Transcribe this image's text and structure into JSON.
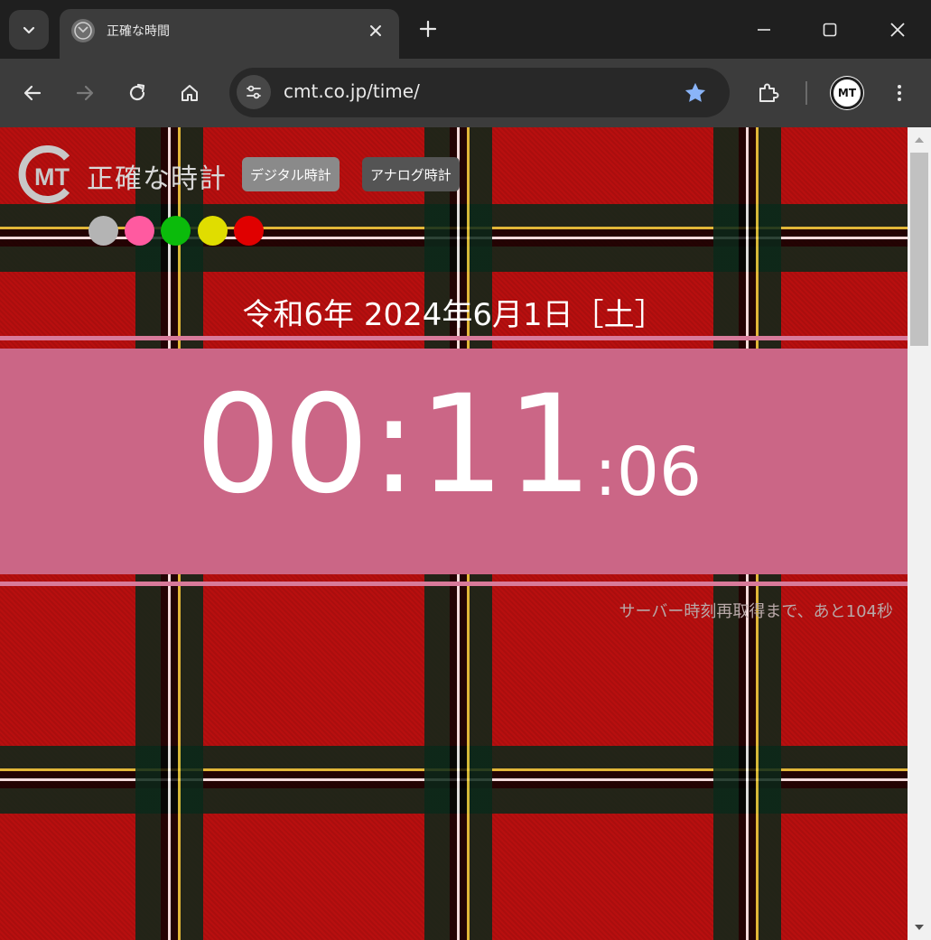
{
  "browser": {
    "tab": {
      "title": "正確な時間"
    },
    "omnibox": {
      "url": "cmt.co.jp/time/"
    },
    "profile": {
      "initials": "MT"
    },
    "accent_color": "#8ab4f8"
  },
  "page": {
    "logo_text": "MT",
    "site_title": "正確な時計",
    "mode_buttons": {
      "digital": "デジタル時計",
      "analog": "アナログ時計"
    },
    "theme_swatches": [
      {
        "name": "gray",
        "color": "#b4b4b4"
      },
      {
        "name": "pink",
        "color": "#ff5aa0"
      },
      {
        "name": "green",
        "color": "#0bbb0b"
      },
      {
        "name": "yellow",
        "color": "#e0dd00"
      },
      {
        "name": "red",
        "color": "#e00000"
      }
    ],
    "date_line": "令和6年 2024年6月1日［土］",
    "clock": {
      "hours_minutes": "00:11",
      "seconds": ":06"
    },
    "refetch_notice": "サーバー時刻再取得まで、あと104秒",
    "band_color": "#cb6686"
  }
}
